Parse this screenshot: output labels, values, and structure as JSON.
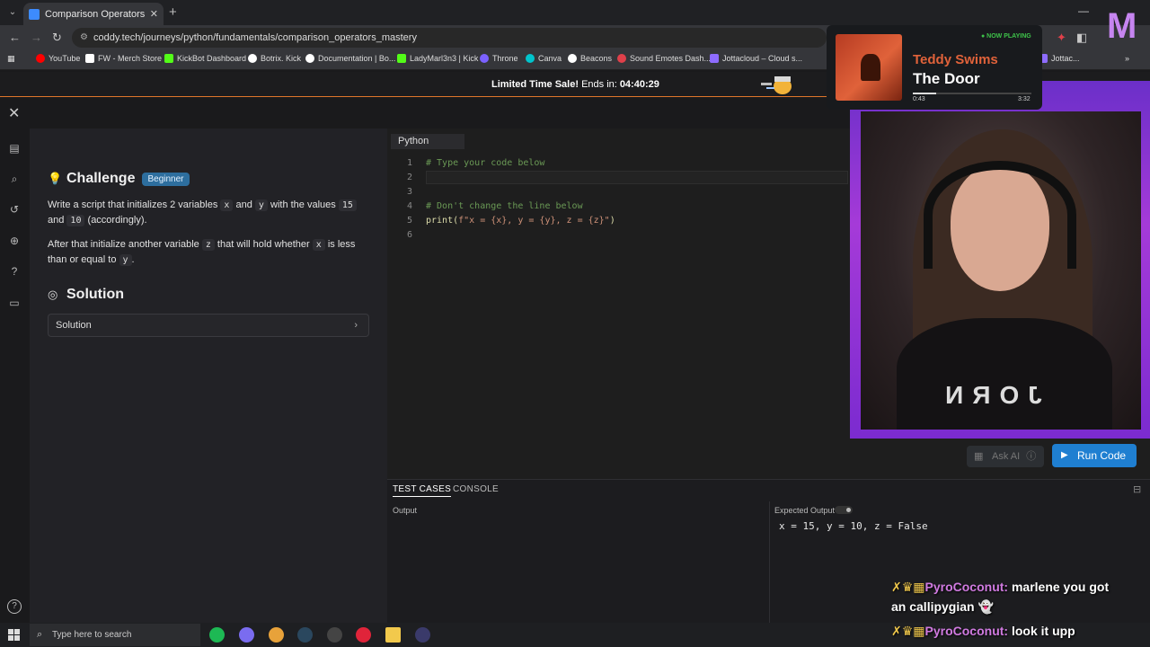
{
  "browser": {
    "tab_title": "Comparison Operators | Python",
    "tab_close": "✕",
    "new_tab": "+",
    "url": "coddy.tech/journeys/python/fundamentals/comparison_operators_mastery",
    "bookmarks": [
      {
        "label": "YouTube",
        "color": "#ff0000"
      },
      {
        "label": "FW - Merch Store",
        "color": "#ffffff"
      },
      {
        "label": "KickBot Dashboard",
        "color": "#53fc18"
      },
      {
        "label": "Botrix. Kick",
        "color": "#ffffff"
      },
      {
        "label": "Documentation | Bo...",
        "color": "#ffffff"
      },
      {
        "label": "LadyMarl3n3 | Kick",
        "color": "#53fc18"
      },
      {
        "label": "Throne",
        "color": "#7b61ff"
      },
      {
        "label": "Canva",
        "color": "#00c4cc"
      },
      {
        "label": "Beacons",
        "color": "#ffffff"
      },
      {
        "label": "Sound Emotes Dash...",
        "color": "#e0404a"
      },
      {
        "label": "Jottacloud – Cloud s...",
        "color": "#8e6cff"
      },
      {
        "label": "Jottac...",
        "color": "#8e6cff"
      }
    ]
  },
  "sale": {
    "text": "Limited Time Sale!",
    "ends_label": "Ends in:",
    "countdown": "04:40:29"
  },
  "challenge": {
    "title": "Challenge",
    "level": "Beginner",
    "p1": {
      "t1": "Write a script that initializes 2 variables",
      "v1": "x",
      "t2": "and",
      "v2": "y",
      "t3": "with the values",
      "n1": "15",
      "t4": "and",
      "n2": "10",
      "t5": "(accordingly)."
    },
    "p2": {
      "t1": "After that initialize another variable",
      "v1": "z",
      "t2": "that will hold whether",
      "v2": "x",
      "t3": "is less than or equal to",
      "v3": "y",
      "t4": "."
    },
    "solution_title": "Solution",
    "solution_button": "Solution"
  },
  "editor": {
    "language": "Python",
    "lines": [
      {
        "num": "1",
        "text": "# Type your code below",
        "kind": "comment"
      },
      {
        "num": "2",
        "text": "",
        "kind": "plain"
      },
      {
        "num": "3",
        "text": "",
        "kind": "plain"
      },
      {
        "num": "4",
        "text": "# Don't change the line below",
        "kind": "comment"
      },
      {
        "num": "5",
        "text": "",
        "kind": "print"
      },
      {
        "num": "6",
        "text": "",
        "kind": "plain"
      }
    ],
    "print_fn": "print(",
    "print_str": "f\"x = {x}, y = {y}, z = {z}\"",
    "print_close": ")",
    "ask_ai": "Ask AI",
    "run_code": "Run Code"
  },
  "bottom": {
    "tabs": [
      "TEST CASES",
      "CONSOLE"
    ],
    "output_label": "Output",
    "expected_label": "Expected Output",
    "expected_value": "x = 15, y = 10, z = False"
  },
  "now_playing": {
    "status": "● NOW PLAYING",
    "artist": "Teddy Swims",
    "song": "The Door",
    "elapsed": "0:43",
    "duration": "3:32",
    "progress": 0.2
  },
  "webcam": {
    "shirt_text": "JORN"
  },
  "chat": [
    {
      "user": "PyroCoconut:",
      "message": "marlene you got"
    },
    {
      "user": "",
      "message": "an callipygian"
    },
    {
      "user": "PyroCoconut:",
      "message": "look it upp"
    }
  ],
  "taskbar": {
    "search_placeholder": "Type here to search",
    "apps": [
      {
        "name": "spotify-icon",
        "color": "#1db954"
      },
      {
        "name": "discord-icon",
        "color": "#7a6cf0"
      },
      {
        "name": "chrome-icon",
        "color": "#e8a23a"
      },
      {
        "name": "steam-icon",
        "color": "#2a475e"
      },
      {
        "name": "obs-icon",
        "color": "#444444"
      },
      {
        "name": "opera-icon",
        "color": "#e0243a"
      },
      {
        "name": "file-explorer-icon",
        "color": "#f2c94c"
      },
      {
        "name": "terminal-icon",
        "color": "#3a3a6a"
      }
    ]
  }
}
